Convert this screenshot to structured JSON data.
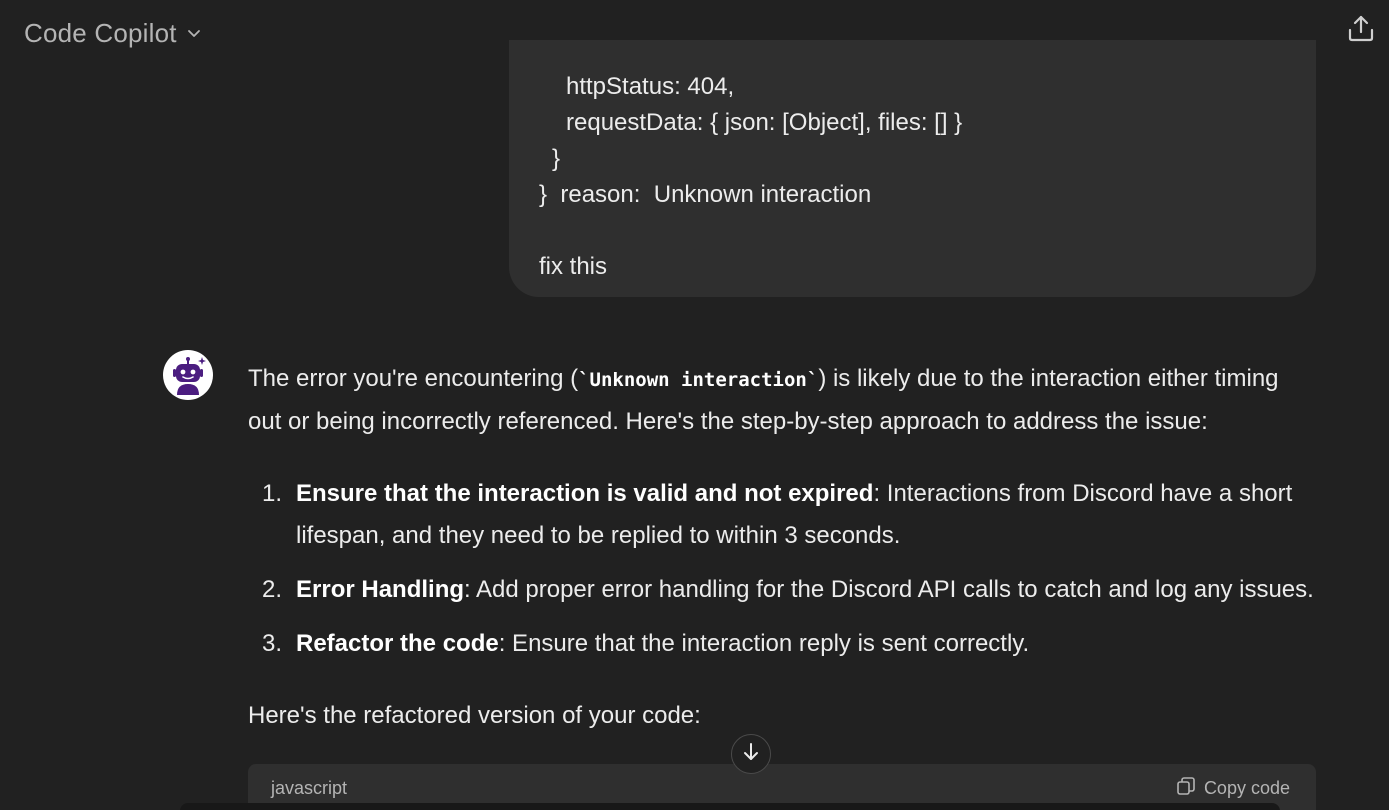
{
  "header": {
    "title": "Code Copilot",
    "chevron_icon": "chevron-down-icon",
    "share_icon": "share-upload-icon"
  },
  "user_message": {
    "lines": [
      "httpStatus: 404,",
      "requestData: { json: [Object], files: [] }",
      "}",
      "}  reason:  Unknown interaction",
      "fix this"
    ]
  },
  "assistant": {
    "avatar_icon": "robot-avatar-icon",
    "intro_before": "The error you're encountering (",
    "intro_code": "`Unknown interaction`",
    "intro_after": ") is likely due to the interaction either timing out or being incorrectly referenced. Here's the step-by-step approach to address the issue:",
    "steps": [
      {
        "num": "1.",
        "title": "Ensure that the interaction is valid and not expired",
        "text": ": Interactions from Discord have a short lifespan, and they need to be replied to within 3 seconds."
      },
      {
        "num": "2.",
        "title": "Error Handling",
        "text": ": Add proper error handling for the Discord API calls to catch and log any issues."
      },
      {
        "num": "3.",
        "title": "Refactor the code",
        "text": ": Ensure that the interaction reply is sent correctly."
      }
    ],
    "outro": "Here's the refactored version of your code:"
  },
  "code_block": {
    "language": "javascript",
    "copy_label": "Copy code",
    "copy_icon": "copy-icon"
  },
  "scroll_button": {
    "icon": "arrow-down-icon"
  },
  "colors": {
    "background": "#212121",
    "bubble": "#2f2f2f",
    "avatar_accent": "#4b1d80"
  }
}
